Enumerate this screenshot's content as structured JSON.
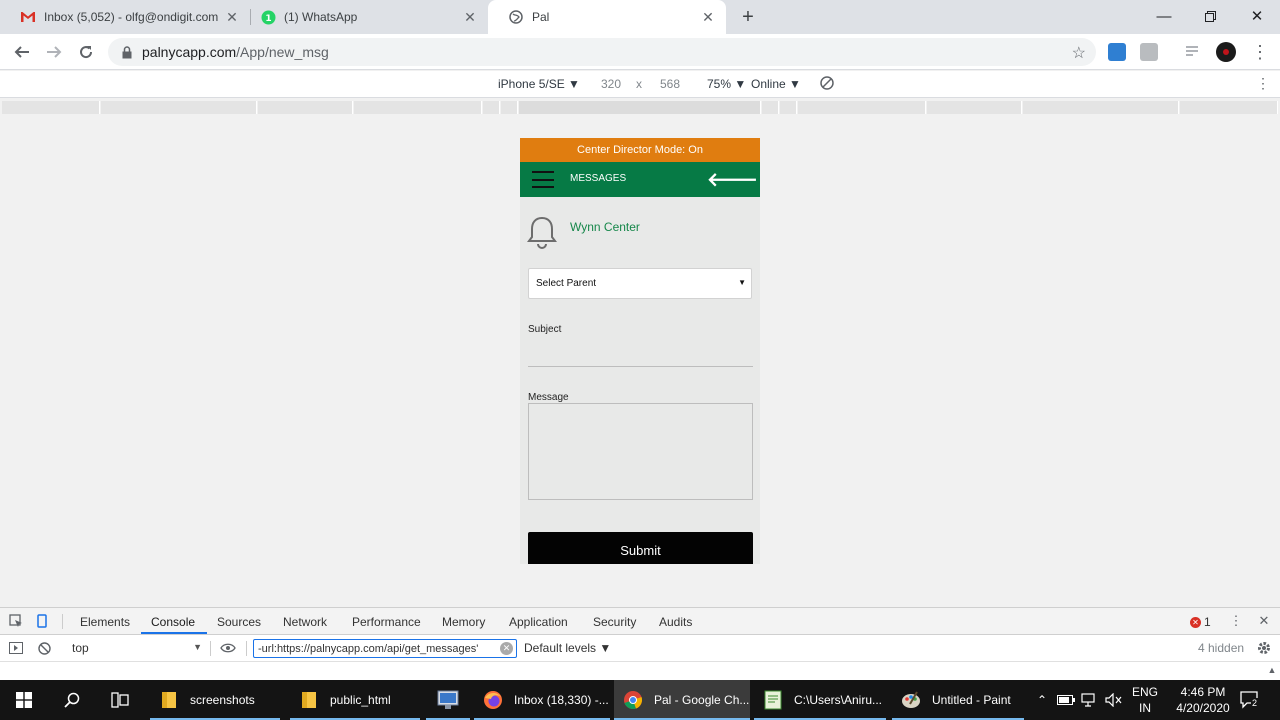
{
  "browser": {
    "tabs": [
      {
        "title": "Inbox (5,052) - olfg@ondigit.com",
        "icon": "gmail-icon"
      },
      {
        "title": "(1) WhatsApp",
        "icon": "whatsapp-icon"
      },
      {
        "title": "Pal",
        "icon": "globe-icon"
      }
    ],
    "url_host": "palnycapp.com",
    "url_path": "/App/new_msg"
  },
  "device_toolbar": {
    "device": "iPhone 5/SE ▼",
    "width": "320",
    "times": "x",
    "height": "568",
    "zoom": "75% ▼",
    "network": "Online ▼"
  },
  "app": {
    "director_banner": "Center Director Mode: On",
    "header_title": "MESSAGES",
    "center_name": "Wynn Center",
    "select_parent": "Select Parent",
    "subject_label": "Subject",
    "message_label": "Message",
    "submit_label": "Submit",
    "colors": {
      "banner": "#e07d10",
      "header": "#067a45",
      "center_text": "#16874a",
      "submit": "#030303"
    }
  },
  "devtools": {
    "tabs": [
      "Elements",
      "Console",
      "Sources",
      "Network",
      "Performance",
      "Memory",
      "Application",
      "Security",
      "Audits"
    ],
    "active_tab": "Console",
    "error_count": "1",
    "context": "top",
    "filter_value": "-url:https://palnycapp.com/api/get_messages'",
    "levels": "Default levels ▼",
    "hidden": "4 hidden"
  },
  "taskbar": {
    "apps": [
      {
        "label": "screenshots",
        "icon": "folder-icon"
      },
      {
        "label": "public_html",
        "icon": "folder-icon"
      },
      {
        "label": "",
        "icon": "remote-desktop-icon"
      },
      {
        "label": "Inbox (18,330) -...",
        "icon": "firefox-icon"
      },
      {
        "label": "Pal - Google Ch...",
        "icon": "chrome-icon"
      },
      {
        "label": "C:\\Users\\Aniru...",
        "icon": "notepad-icon"
      },
      {
        "label": "Untitled - Paint",
        "icon": "paint-icon"
      }
    ],
    "lang_top": "ENG",
    "lang_bottom": "IN",
    "time": "4:46 PM",
    "date": "4/20/2020",
    "notifications": "2"
  }
}
